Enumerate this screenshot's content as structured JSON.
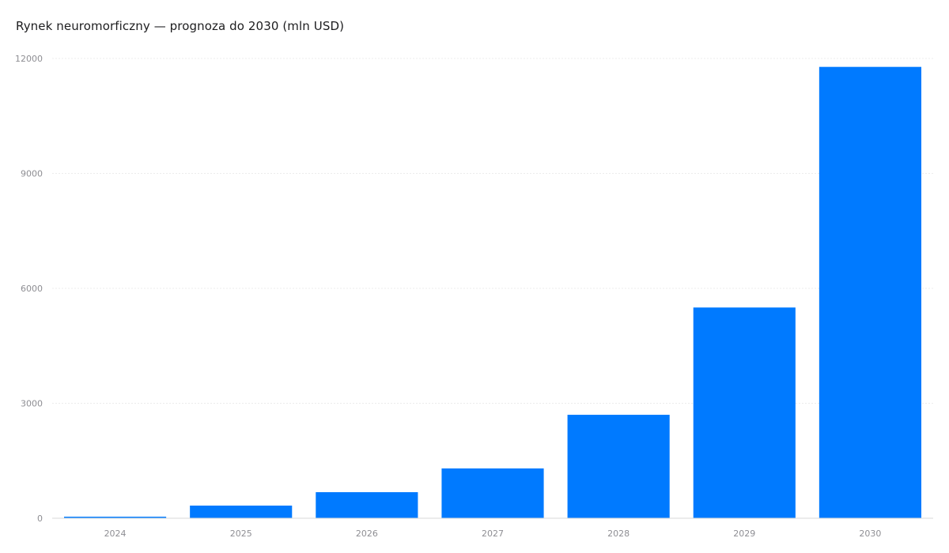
{
  "chart_data": {
    "type": "bar",
    "title": "Rynek neuromorficzny — prognoza do 2030 (mln USD)",
    "xlabel": "",
    "ylabel": "",
    "categories": [
      "2024",
      "2025",
      "2026",
      "2027",
      "2028",
      "2029",
      "2030"
    ],
    "values": [
      40,
      330,
      680,
      1300,
      2700,
      5500,
      11780
    ],
    "ylim": [
      0,
      12000
    ],
    "yticks": [
      "0",
      "3000",
      "6000",
      "9000",
      "12000"
    ],
    "grid": true,
    "legend": "none",
    "colors": {
      "bar": "#007aff",
      "grid": "#ececec",
      "axis": "#d9d9d9",
      "tick_text": "#8e8e93",
      "title_text": "#1d1d1f"
    }
  }
}
